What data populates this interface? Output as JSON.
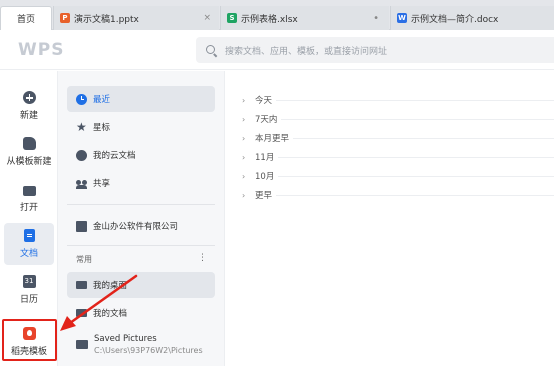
{
  "tabs": [
    {
      "label": "首页",
      "type": "home"
    },
    {
      "label": "演示文稿1.pptx",
      "type": "ppt",
      "color": "#e8612b",
      "icon_glyph": "P",
      "close": "×"
    },
    {
      "label": "示例表格.xlsx",
      "type": "xls",
      "color": "#1fa463",
      "icon_glyph": "S",
      "close": "•"
    },
    {
      "label": "示例文档—简介.docx",
      "type": "doc",
      "color": "#2b6fe5",
      "icon_glyph": "W",
      "close": ""
    }
  ],
  "header": {
    "logo": "WPS",
    "search_placeholder": "搜索文档、应用、模板，或直接访问网址"
  },
  "rail": [
    {
      "label": "新建",
      "icon": "plus-circle-icon"
    },
    {
      "label": "从模板新建",
      "icon": "template-icon"
    },
    {
      "label": "打开",
      "icon": "folder-icon"
    },
    {
      "label": "文档",
      "icon": "document-icon",
      "active": true
    },
    {
      "label": "日历",
      "icon": "calendar-icon"
    },
    {
      "label": "稻壳模板",
      "icon": "docer-shell-icon",
      "highlighted": true
    }
  ],
  "nav": {
    "items": [
      {
        "label": "最近",
        "icon": "clock-icon",
        "active": true
      },
      {
        "label": "星标",
        "icon": "star-icon"
      },
      {
        "label": "我的云文档",
        "icon": "cloud-icon"
      },
      {
        "label": "共享",
        "icon": "share-users-icon"
      },
      {
        "label": "金山办公软件有限公司",
        "icon": "organization-icon"
      }
    ],
    "section_label": "常用",
    "section_more": "⋮",
    "common": [
      {
        "label": "我的桌面",
        "icon": "desktop-folder-icon",
        "active": true
      },
      {
        "label": "我的文档",
        "icon": "documents-folder-icon"
      },
      {
        "label": "Saved Pictures",
        "sub": "C:\\Users\\93P76W2\\Pictures",
        "icon": "pictures-folder-icon"
      }
    ]
  },
  "groups": [
    "今天",
    "7天内",
    "本月更早",
    "11月",
    "10月",
    "更早"
  ],
  "group_chevron": "›",
  "colors": {
    "accent": "#1f6fe5",
    "annotation": "#e2231a"
  }
}
